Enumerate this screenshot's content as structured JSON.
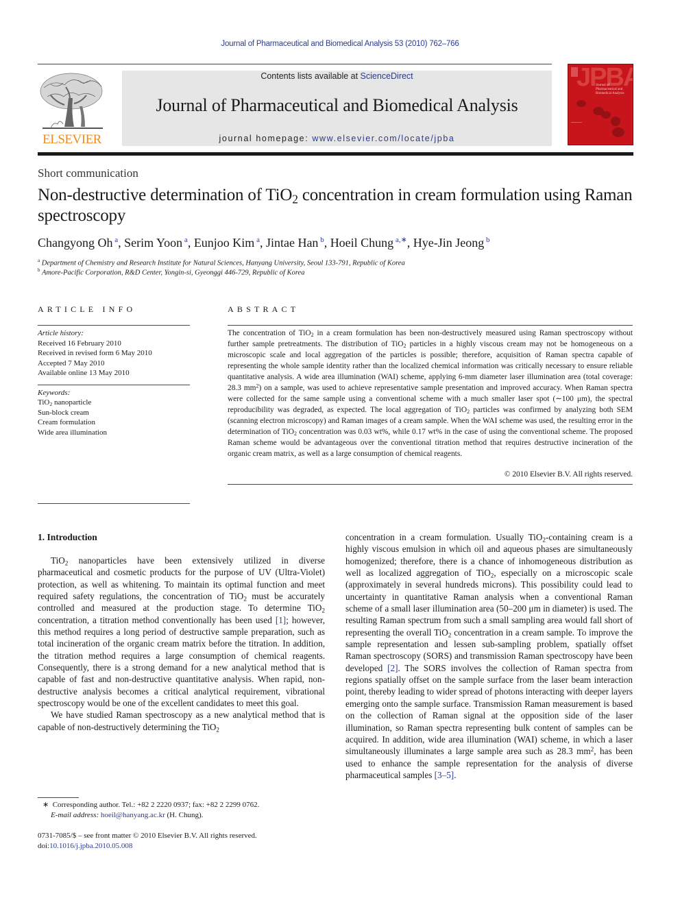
{
  "running_head": "Journal of Pharmaceutical and Biomedical Analysis 53 (2010) 762–766",
  "banner": {
    "contents_prefix": "Contents lists available at ",
    "contents_link": "ScienceDirect",
    "journal_name": "Journal of Pharmaceutical and Biomedical Analysis",
    "homepage_prefix": "journal homepage: ",
    "homepage_link": "www.elsevier.com/locate/jpba"
  },
  "publisher_logo": {
    "icon": "elsevier-tree-logo",
    "wordmark": "ELSEVIER",
    "color": "#f08a1e"
  },
  "cover": {
    "title": "JPBA",
    "subtitle": "Journal of Pharmaceutical and Biomedical Analysis",
    "color": "#c8151b"
  },
  "article_type": "Short communication",
  "title": {
    "part1": "Non-destructive determination of TiO",
    "sub": "2",
    "part2": " concentration in cream formulation using Raman spectroscopy"
  },
  "authors": [
    {
      "name": "Changyong Oh",
      "aff": "a",
      "sep": ", "
    },
    {
      "name": "Serim Yoon",
      "aff": "a",
      "sep": ", "
    },
    {
      "name": "Eunjoo Kim",
      "aff": "a",
      "sep": ", "
    },
    {
      "name": "Jintae Han",
      "aff": "b",
      "sep": ", "
    },
    {
      "name": "Hoeil Chung",
      "aff": "a,∗",
      "sep": ", "
    },
    {
      "name": "Hye-Jin Jeong",
      "aff": "b",
      "sep": ""
    }
  ],
  "affiliations": [
    {
      "key": "a",
      "text": "Department of Chemistry and Research Institute for Natural Sciences, Hanyang University, Seoul 133-791, Republic of Korea"
    },
    {
      "key": "b",
      "text": "Amore-Pacific Corporation, R&D Center, Yongin-si, Gyeonggi 446-729, Republic of Korea"
    }
  ],
  "article_info": {
    "heading": "ARTICLE INFO",
    "history_label": "Article history:",
    "history": [
      "Received 16 February 2010",
      "Received in revised form 6 May 2010",
      "Accepted 7 May 2010",
      "Available online 13 May 2010"
    ],
    "keywords_label": "Keywords:",
    "keywords": [
      {
        "pre": "TiO",
        "sub": "2",
        "post": " nanoparticle"
      },
      {
        "pre": "Sun-block cream",
        "sub": "",
        "post": ""
      },
      {
        "pre": "Cream formulation",
        "sub": "",
        "post": ""
      },
      {
        "pre": "Wide area illumination",
        "sub": "",
        "post": ""
      }
    ]
  },
  "abstract": {
    "heading": "ABSTRACT",
    "segments": [
      {
        "t": "The concentration of TiO"
      },
      {
        "sub": "2"
      },
      {
        "t": " in a cream formulation has been non-destructively measured using Raman spectroscopy without further sample pretreatments. The distribution of TiO"
      },
      {
        "sub": "2"
      },
      {
        "t": " particles in a highly viscous cream may not be homogeneous on a microscopic scale and local aggregation of the particles is possible; therefore, acquisition of Raman spectra capable of representing the whole sample identity rather than the localized chemical information was critically necessary to ensure reliable quantitative analysis. A wide area illumination (WAI) scheme, applying 6-mm diameter laser illumination area (total coverage: 28.3 mm"
      },
      {
        "sup": "2"
      },
      {
        "t": ") on a sample, was used to achieve representative sample presentation and improved accuracy. When Raman spectra were collected for the same sample using a conventional scheme with a much smaller laser spot (∼100 μm), the spectral reproducibility was degraded, as expected. The local aggregation of TiO"
      },
      {
        "sub": "2"
      },
      {
        "t": " particles was confirmed by analyzing both SEM (scanning electron microscopy) and Raman images of a cream sample. When the WAI scheme was used, the resulting error in the determination of TiO"
      },
      {
        "sub": "2"
      },
      {
        "t": " concentration was 0.03 wt%, while 0.17 wt% in the case of using the conventional scheme. The proposed Raman scheme would be advantageous over the conventional titration method that requires destructive incineration of the organic cream matrix, as well as a large consumption of chemical reagents."
      }
    ],
    "copyright": "© 2010 Elsevier B.V. All rights reserved."
  },
  "introduction": {
    "heading": "1.  Introduction",
    "col1_paragraphs": [
      [
        {
          "t": "TiO"
        },
        {
          "sub": "2"
        },
        {
          "t": " nanoparticles have been extensively utilized in diverse pharmaceutical and cosmetic products for the purpose of UV (Ultra-Violet) protection, as well as whitening. To maintain its optimal function and meet required safety regulations, the concentration of TiO"
        },
        {
          "sub": "2"
        },
        {
          "t": " must be accurately controlled and measured at the production stage. To determine TiO"
        },
        {
          "sub": "2"
        },
        {
          "t": " concentration, a titration method conventionally has been used "
        },
        {
          "ref": "[1]"
        },
        {
          "t": "; however, this method requires a long period of destructive sample preparation, such as total incineration of the organic cream matrix before the titration. In addition, the titration method requires a large consumption of chemical reagents. Consequently, there is a strong demand for a new analytical method that is capable of fast and non-destructive quantitative analysis. When rapid, non-destructive analysis becomes a critical analytical requirement, vibrational spectroscopy would be one of the excellent candidates to meet this goal."
        }
      ],
      [
        {
          "t": "We have studied Raman spectroscopy as a new analytical method that is capable of non-destructively determining the TiO"
        },
        {
          "sub": "2"
        }
      ]
    ],
    "col2_paragraphs": [
      [
        {
          "t": "concentration in a cream formulation. Usually TiO"
        },
        {
          "sub": "2"
        },
        {
          "t": "-containing cream is a highly viscous emulsion in which oil and aqueous phases are simultaneously homogenized; therefore, there is a chance of inhomogeneous distribution as well as localized aggregation of TiO"
        },
        {
          "sub": "2"
        },
        {
          "t": ", especially on a microscopic scale (approximately in several hundreds microns). This possibility could lead to uncertainty in quantitative Raman analysis when a conventional Raman scheme of a small laser illumination area (50–200 μm in diameter) is used. The resulting Raman spectrum from such a small sampling area would fall short of representing the overall TiO"
        },
        {
          "sub": "2"
        },
        {
          "t": " concentration in a cream sample. To improve the sample representation and lessen sub-sampling problem, spatially offset Raman spectroscopy (SORS) and transmission Raman spectroscopy have been developed "
        },
        {
          "ref": "[2]"
        },
        {
          "t": ". The SORS involves the collection of Raman spectra from regions spatially offset on the sample surface from the laser beam interaction point, thereby leading to wider spread of photons interacting with deeper layers emerging onto the sample surface. Transmission Raman measurement is based on the collection of Raman signal at the opposition side of the laser illumination, so Raman spectra representing bulk content of samples can be acquired. In addition, wide area illumination (WAI) scheme, in which a laser simultaneously illuminates a large sample area such as 28.3 mm"
        },
        {
          "sup": "2"
        },
        {
          "t": ", has been used to enhance the sample representation for the analysis of diverse pharmaceutical samples "
        },
        {
          "ref": "[3–5]"
        },
        {
          "t": "."
        }
      ]
    ]
  },
  "footnote": {
    "marker": "∗",
    "corresponding": "Corresponding author. Tel.: +82 2 2220 0937; fax: +82 2 2299 0762.",
    "email_label": "E-mail address: ",
    "email": "hoeil@hanyang.ac.kr",
    "email_suffix": " (H. Chung)."
  },
  "front_matter": {
    "issn_line": "0731-7085/$ – see front matter © 2010 Elsevier B.V. All rights reserved.",
    "doi_label": "doi:",
    "doi": "10.1016/j.jpba.2010.05.008"
  },
  "colors": {
    "link": "#2b3a8c",
    "banner_bg": "#e6e6e6",
    "elsevier_orange": "#f08a1e",
    "cover_red": "#c8151b"
  }
}
